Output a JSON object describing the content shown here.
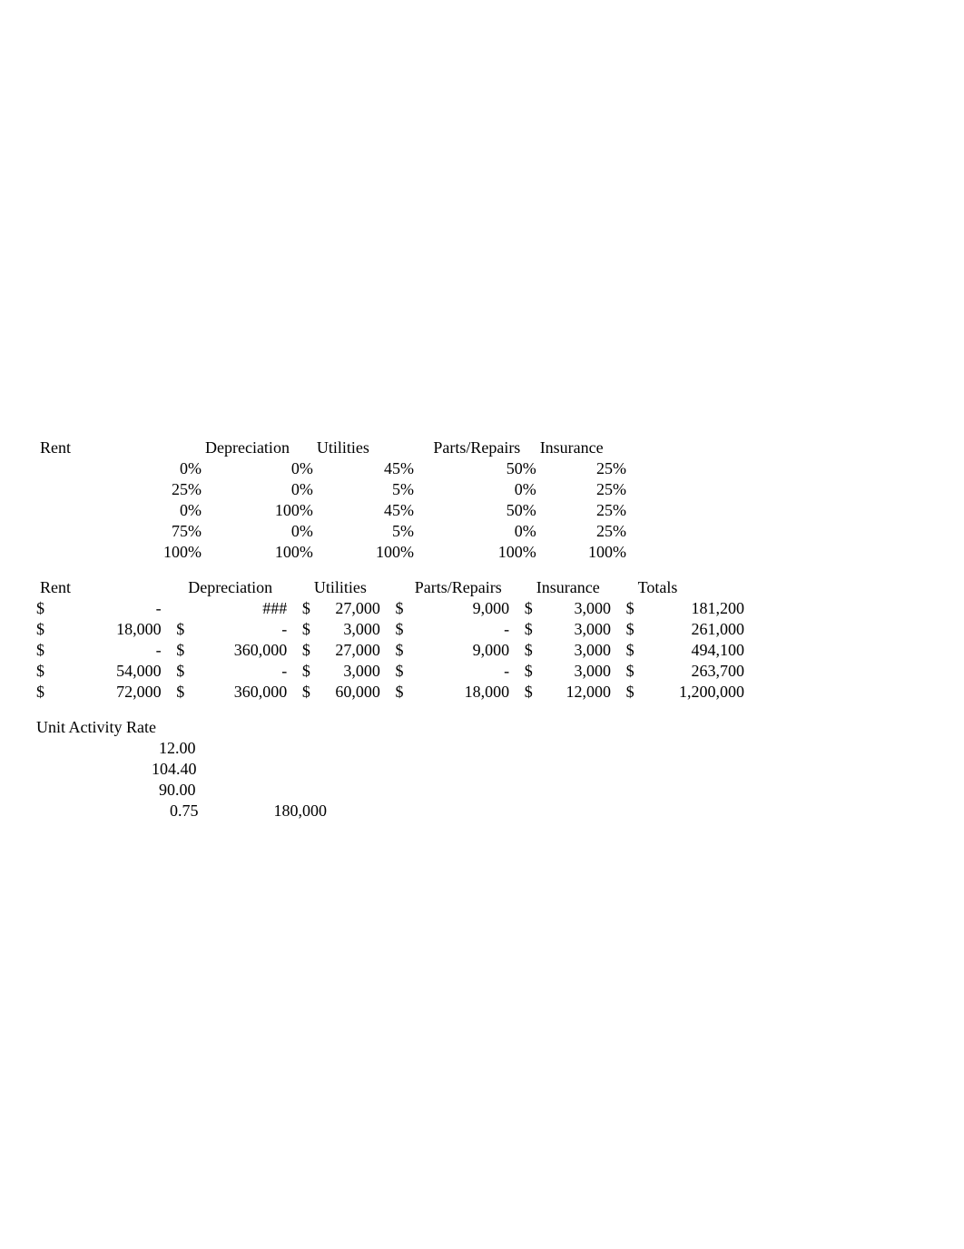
{
  "table1": {
    "headers": {
      "rent": "Rent",
      "depreciation": "Depreciation",
      "utilities": "Utilities",
      "parts_repairs": "Parts/Repairs",
      "insurance": "Insurance"
    },
    "rows": [
      {
        "rent": "0%",
        "depreciation": "0%",
        "utilities": "45%",
        "parts_repairs": "50%",
        "insurance": "25%"
      },
      {
        "rent": "25%",
        "depreciation": "0%",
        "utilities": "5%",
        "parts_repairs": "0%",
        "insurance": "25%"
      },
      {
        "rent": "0%",
        "depreciation": "100%",
        "utilities": "45%",
        "parts_repairs": "50%",
        "insurance": "25%"
      },
      {
        "rent": "75%",
        "depreciation": "0%",
        "utilities": "5%",
        "parts_repairs": "0%",
        "insurance": "25%"
      },
      {
        "rent": "100%",
        "depreciation": "100%",
        "utilities": "100%",
        "parts_repairs": "100%",
        "insurance": "100%"
      }
    ]
  },
  "table2": {
    "headers": {
      "rent": "Rent",
      "depreciation": "Depreciation",
      "utilities": "Utilities",
      "parts_repairs": "Parts/Repairs",
      "insurance": "Insurance",
      "totals": "Totals"
    },
    "rows": [
      {
        "lbl": "$",
        "rent": "-",
        "dep_s": "",
        "dep_v": "###",
        "util_s": "$",
        "util_v": "27,000",
        "parts_s": "$",
        "parts_v": "9,000",
        "ins_s": "$",
        "ins_v": "3,000",
        "tot_s": "$",
        "tot_v": "181,200"
      },
      {
        "lbl": "$",
        "rent": "18,000",
        "dep_s": "$",
        "dep_v": "-",
        "util_s": "$",
        "util_v": "3,000",
        "parts_s": "$",
        "parts_v": "-",
        "ins_s": "$",
        "ins_v": "3,000",
        "tot_s": "$",
        "tot_v": "261,000"
      },
      {
        "lbl": "$",
        "rent": "-",
        "dep_s": "$",
        "dep_v": "360,000",
        "util_s": "$",
        "util_v": "27,000",
        "parts_s": "$",
        "parts_v": "9,000",
        "ins_s": "$",
        "ins_v": "3,000",
        "tot_s": "$",
        "tot_v": "494,100"
      },
      {
        "lbl": "$",
        "rent": "54,000",
        "dep_s": "$",
        "dep_v": "-",
        "util_s": "$",
        "util_v": "3,000",
        "parts_s": "$",
        "parts_v": "-",
        "ins_s": "$",
        "ins_v": "3,000",
        "tot_s": "$",
        "tot_v": "263,700"
      },
      {
        "lbl": "$",
        "rent": "72,000",
        "dep_s": "$",
        "dep_v": "360,000",
        "util_s": "$",
        "util_v": "60,000",
        "parts_s": "$",
        "parts_v": "18,000",
        "ins_s": "$",
        "ins_v": "12,000",
        "tot_s": "$",
        "tot_v": "1,200,000"
      }
    ]
  },
  "unit_activity": {
    "title": "Unit Activity Rate",
    "rows": [
      {
        "v1": "12.00",
        "v2": ""
      },
      {
        "v1": "104.40",
        "v2": ""
      },
      {
        "v1": "90.00",
        "v2": ""
      },
      {
        "v1": "0.75",
        "v2": "180,000"
      }
    ]
  }
}
